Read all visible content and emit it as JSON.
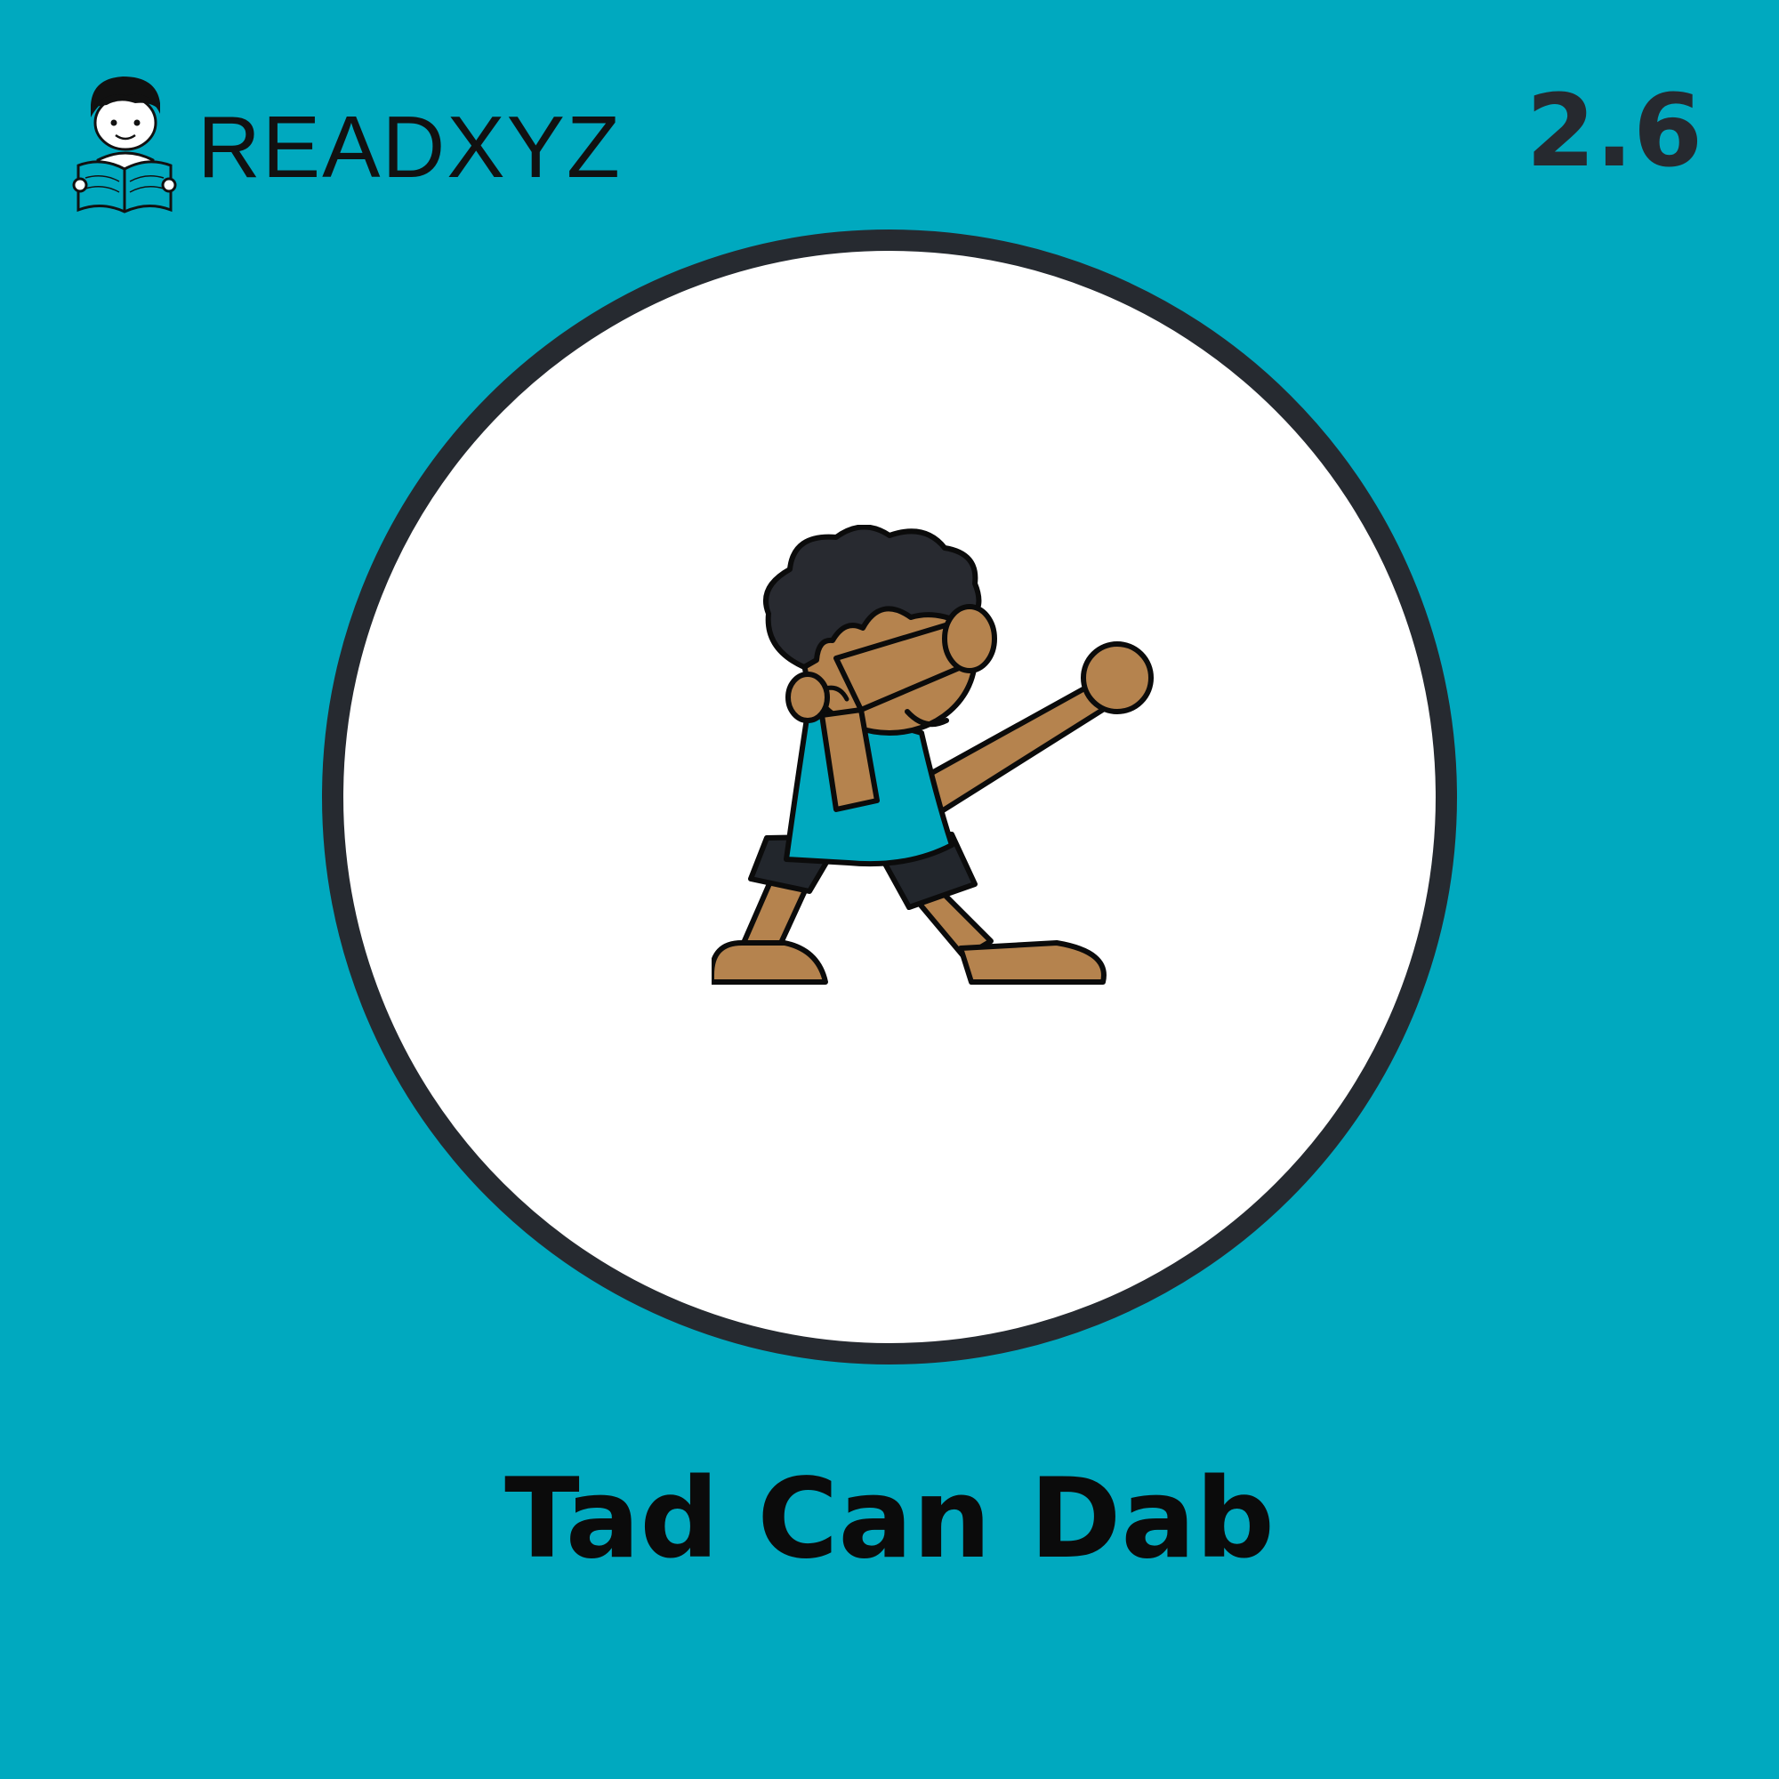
{
  "brand": {
    "name": "READXYZ",
    "mascot_icon": "reading-boy-icon"
  },
  "level": "2.6",
  "illustration": {
    "icon": "dabbing-boy-icon",
    "skin_color": "#b5834e",
    "shirt_color": "#00a9bf",
    "hair_color": "#282a30"
  },
  "title": "Tad Can Dab",
  "colors": {
    "background": "#00a9bf",
    "ring": "#262a30",
    "disc": "#ffffff"
  }
}
